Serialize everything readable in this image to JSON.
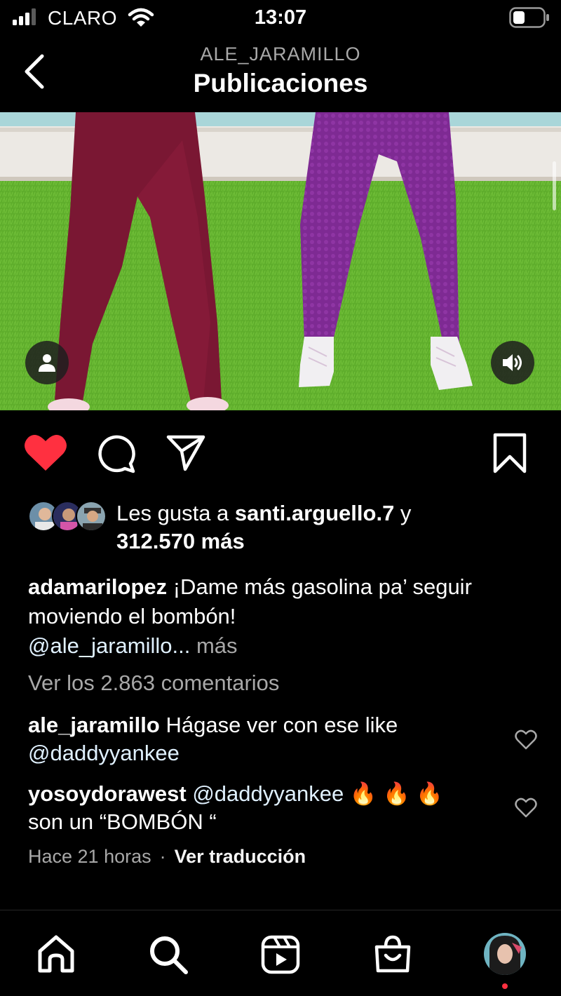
{
  "status_bar": {
    "carrier": "CLARO",
    "time": "13:07",
    "icons": [
      "signal-icon",
      "wifi-icon",
      "battery-icon"
    ]
  },
  "header": {
    "username": "ALE_JARAMILLO",
    "title": "Publicaciones",
    "back_icon": "chevron-left-icon"
  },
  "media": {
    "tag_icon": "user-tag-icon",
    "volume_icon": "volume-icon"
  },
  "actions": {
    "liked": true,
    "like_color": "#ff3040",
    "icons": [
      "heart-icon",
      "comment-icon",
      "send-icon",
      "bookmark-icon"
    ]
  },
  "likes": {
    "prefix": "Les gusta a ",
    "user": "santi.arguello.7",
    "joiner": " y",
    "count": "312.570 más"
  },
  "caption": {
    "username": "adamarilopez",
    "text": " ¡Dame más gasolina pa’ seguir moviendo el bombón!",
    "mention": "@ale_jaramillo...",
    "more": " más"
  },
  "view_comments": "Ver los 2.863 comentarios",
  "comments": [
    {
      "username": "ale_jaramillo",
      "text": " Hágase ver con ese like",
      "mention": "@daddyyankee"
    },
    {
      "username": "yosoydorawest",
      "mention": " @daddyyankee",
      "emoji": " 🔥 🔥 🔥",
      "text": " son un “BOMBÓN “"
    }
  ],
  "meta": {
    "time_ago": "Hace 21 horas",
    "separator": "·",
    "translate": "Ver traducción"
  },
  "bottom_nav": {
    "items": [
      "home-icon",
      "search-icon",
      "reels-icon",
      "shop-icon",
      "profile-avatar"
    ],
    "notification_color": "#ff3040"
  }
}
